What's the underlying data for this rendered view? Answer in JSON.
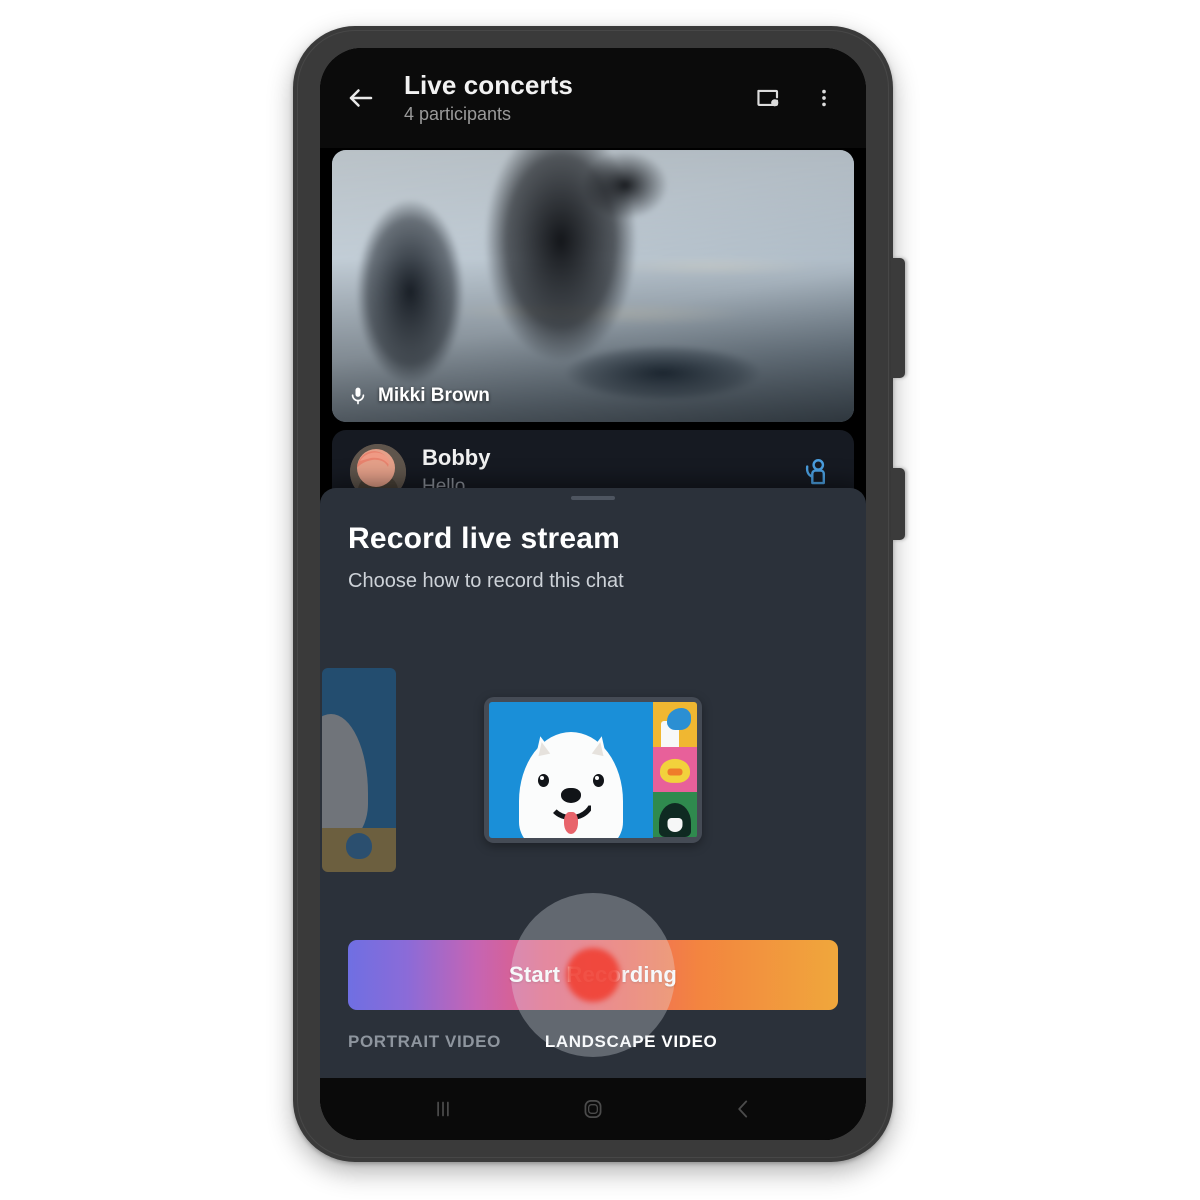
{
  "app": {
    "header": {
      "title": "Live concerts",
      "subtitle": "4 participants",
      "back_icon": "arrow-left-icon",
      "pip_icon": "picture-in-picture-icon",
      "overflow_icon": "more-vertical-icon"
    },
    "video_tile": {
      "speaker_name": "Mikki Brown",
      "mic_icon": "microphone-icon"
    },
    "messages": [
      {
        "name": "Bobby",
        "preview": "Hello",
        "action_icon": "raise-hand-icon",
        "action_color": "#4a9fe0"
      }
    ]
  },
  "sheet": {
    "title": "Record live stream",
    "subtitle": "Choose how to record this chat",
    "primary_button": "Start Recording",
    "tabs": [
      {
        "label": "PORTRAIT VIDEO",
        "active": false
      },
      {
        "label": "LANDSCAPE VIDEO",
        "active": true
      }
    ],
    "illustration": {
      "name": "landscape-video-layout",
      "main_tile": "dog-avatar",
      "side_tiles": [
        "bird-avatar",
        "duck-avatar",
        "person-avatar"
      ]
    },
    "gradient_start": "#6f6fe2",
    "gradient_end": "#f0a73c"
  },
  "nav_bar": {
    "recents_icon": "recents-icon",
    "home_icon": "home-icon",
    "back_icon": "back-chevron-icon"
  }
}
